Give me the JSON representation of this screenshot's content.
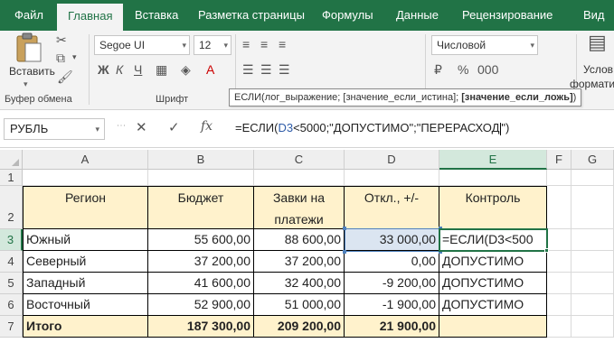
{
  "ribbon_tabs": [
    "Файл",
    "Главная",
    "Вставка",
    "Разметка страницы",
    "Формулы",
    "Данные",
    "Рецензирование",
    "Вид"
  ],
  "active_tab": "Главная",
  "clipboard": {
    "paste_label": "Вставить",
    "group_label": "Буфер обмена"
  },
  "font": {
    "name": "Segoe UI",
    "size": "12",
    "group_label": "Шрифт"
  },
  "number": {
    "format": "Числовой"
  },
  "styles": {
    "partial_label": "Услов",
    "partial_label2": "форматиров"
  },
  "tooltip": {
    "text": "ЕСЛИ(лог_выражение; [значение_если_истина]; ",
    "bold": "[значение_если_ложь]",
    "close": ")"
  },
  "formula_bar": {
    "name_box": "РУБЛЬ",
    "cancel_icon": "✕",
    "enter_icon": "✓",
    "fx_icon": "fx",
    "formula_prefix": "=ЕСЛИ(",
    "formula_ref": "D3",
    "formula_suffix": "<5000;\"ДОПУСТИМО\";\"ПЕРЕРАСХОД",
    "formula_end": "\")"
  },
  "columns": [
    "A",
    "B",
    "C",
    "D",
    "E",
    "F",
    "G"
  ],
  "rows": [
    "1",
    "2",
    "3",
    "4",
    "5",
    "6",
    "7"
  ],
  "table": {
    "headers": {
      "region": "Регион",
      "budget": "Бюджет",
      "requests_line1": "Завки на",
      "requests_line2": "платежи",
      "deviation": "Откл., +/-",
      "control": "Контроль"
    },
    "data": [
      {
        "region": "Южный",
        "budget": "55 600,00",
        "requests": "88 600,00",
        "deviation": "33 000,00",
        "control": "=ЕСЛИ(D3<500"
      },
      {
        "region": "Северный",
        "budget": "37 200,00",
        "requests": "37 200,00",
        "deviation": "0,00",
        "control": "ДОПУСТИМО"
      },
      {
        "region": "Западный",
        "budget": "41 600,00",
        "requests": "32 400,00",
        "deviation": "-9 200,00",
        "control": "ДОПУСТИМО"
      },
      {
        "region": "Восточный",
        "budget": "52 900,00",
        "requests": "51 000,00",
        "deviation": "-1 900,00",
        "control": "ДОПУСТИМО"
      }
    ],
    "total": {
      "region": "Итого",
      "budget": "187 300,00",
      "requests": "209 200,00",
      "deviation": "21 900,00"
    }
  },
  "colors": {
    "ribbon_green": "#217346",
    "header_fill": "#fff2cc",
    "ref_blue": "#4f81bd"
  }
}
